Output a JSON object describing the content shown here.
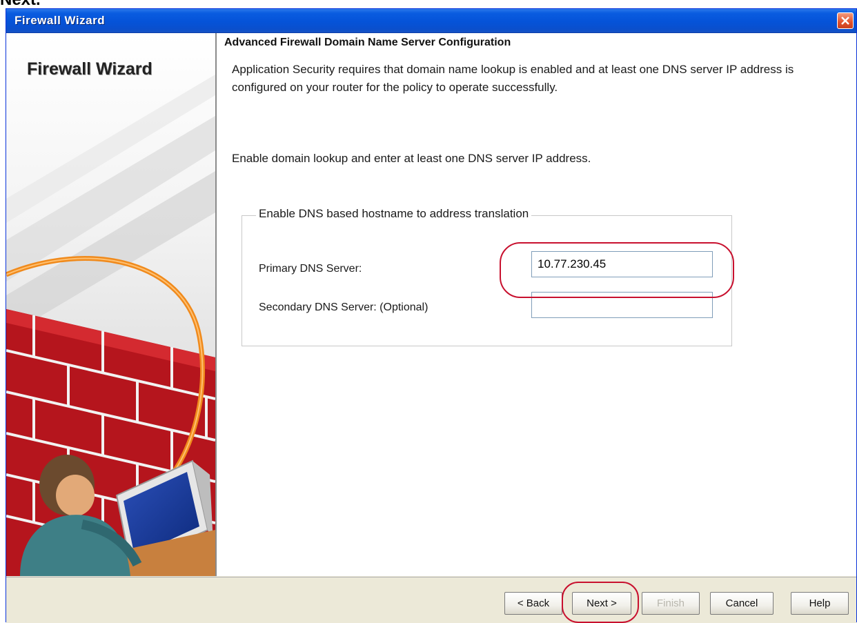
{
  "doc_fragment": "Next.",
  "window": {
    "title": "Firewall Wizard"
  },
  "sidebar": {
    "title": "Firewall Wizard"
  },
  "main": {
    "heading": "Advanced Firewall Domain Name Server Configuration",
    "paragraph1": "Application Security requires that domain name lookup is enabled and at least one DNS server IP address is configured on your router for the policy to operate successfully.",
    "paragraph2": "Enable domain lookup and enter at least one DNS server IP address.",
    "group_label": "Enable DNS based hostname to address translation",
    "primary_label": "Primary DNS Server:",
    "primary_value": "10.77.230.45",
    "secondary_label": "Secondary DNS Server: (Optional)",
    "secondary_value": ""
  },
  "buttons": {
    "back": "< Back",
    "next": "Next >",
    "finish": "Finish",
    "cancel": "Cancel",
    "help": "Help"
  },
  "colors": {
    "titlebar": "#0553d8",
    "highlight": "#c8102e"
  }
}
